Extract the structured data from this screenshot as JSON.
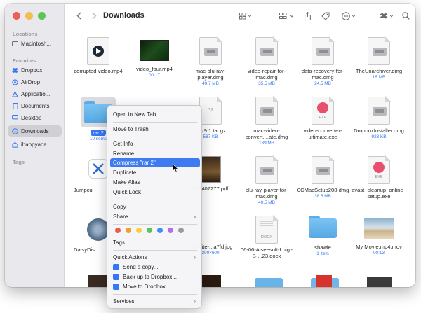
{
  "toolbar": {
    "title": "Downloads"
  },
  "sidebar": {
    "sections": {
      "locations": "Locations",
      "favorites": "Favorites",
      "tags": "Tags"
    },
    "locations": [
      {
        "label": "Macintosh..."
      }
    ],
    "favorites": [
      {
        "label": "Dropbox",
        "icon": "dropbox-icon"
      },
      {
        "label": "AirDrop",
        "icon": "airdrop-icon"
      },
      {
        "label": "Applicatio...",
        "icon": "applications-icon"
      },
      {
        "label": "Documents",
        "icon": "documents-icon"
      },
      {
        "label": "Desktop",
        "icon": "desktop-icon"
      },
      {
        "label": "Downloads",
        "icon": "downloads-icon"
      },
      {
        "label": "ihappyace...",
        "icon": "home-icon"
      }
    ]
  },
  "files": [
    {
      "name": "corrupted video.mp4",
      "sub": ""
    },
    {
      "name": "video_four.mp4",
      "sub": "00:17"
    },
    {
      "name": "mac-blu-ray-player.dmg",
      "sub": "40.7 MB"
    },
    {
      "name": "video-repair-for-mac.dmg",
      "sub": "35.5 MB"
    },
    {
      "name": "data-recovery-for-mac.dmg",
      "sub": "24.5 MB"
    },
    {
      "name": "TheUnarchiver.dmg",
      "sub": "16 MB"
    },
    {
      "name": "rar 2",
      "sub": "10 items"
    },
    {
      "name": "x-5.9.1.tar.gz",
      "sub": "587 KB"
    },
    {
      "name": "mac-video-convert....ate.dmg",
      "sub": "139 MB"
    },
    {
      "name": "video-converter-ultimate.exe",
      "sub": ""
    },
    {
      "name": "DropboxInstaller.dmg",
      "sub": "923 KB"
    },
    {
      "name": "Jumpcu",
      "sub": ""
    },
    {
      "name": "471407277.pdf",
      "sub": ""
    },
    {
      "name": "blu-ray-player-for-mac.dmg",
      "sub": "40.5 MB"
    },
    {
      "name": "CCMacSetup208.dmg",
      "sub": "38.6 MB"
    },
    {
      "name": "avast_cleanup_online_setup.exe",
      "sub": ""
    },
    {
      "name": "DaisyDis",
      "sub": ""
    },
    {
      "name": "re-white-...a7fd.jpg",
      "sub": "200×600"
    },
    {
      "name": "06-06-Aiseesoft-Luigi-B-...23.docx",
      "sub": ""
    },
    {
      "name": "shawie",
      "sub": "1 item"
    },
    {
      "name": "My Movie.mp4.mov",
      "sub": "00:13"
    }
  ],
  "icon_labels": {
    "gz": "GZ",
    "exe": "EXE",
    "docx": "DOCX"
  },
  "context_menu": {
    "open_new_tab": "Open in New Tab",
    "move_trash": "Move to Trash",
    "get_info": "Get Info",
    "rename": "Rename",
    "compress": "Compress \"rar 2\"",
    "duplicate": "Duplicate",
    "make_alias": "Make Alias",
    "quick_look": "Quick Look",
    "copy": "Copy",
    "share": "Share",
    "tags": "Tags...",
    "quick_actions": "Quick Actions",
    "send_copy": "Send a copy...",
    "back_up": "Back up to Dropbox...",
    "move_dropbox": "Move to Dropbox",
    "services": "Services"
  },
  "tag_colors": [
    "#ec5b52",
    "#f0a030",
    "#f6cf3b",
    "#5ec25a",
    "#3e8ef7",
    "#b46fe0",
    "#9a9a9e"
  ]
}
